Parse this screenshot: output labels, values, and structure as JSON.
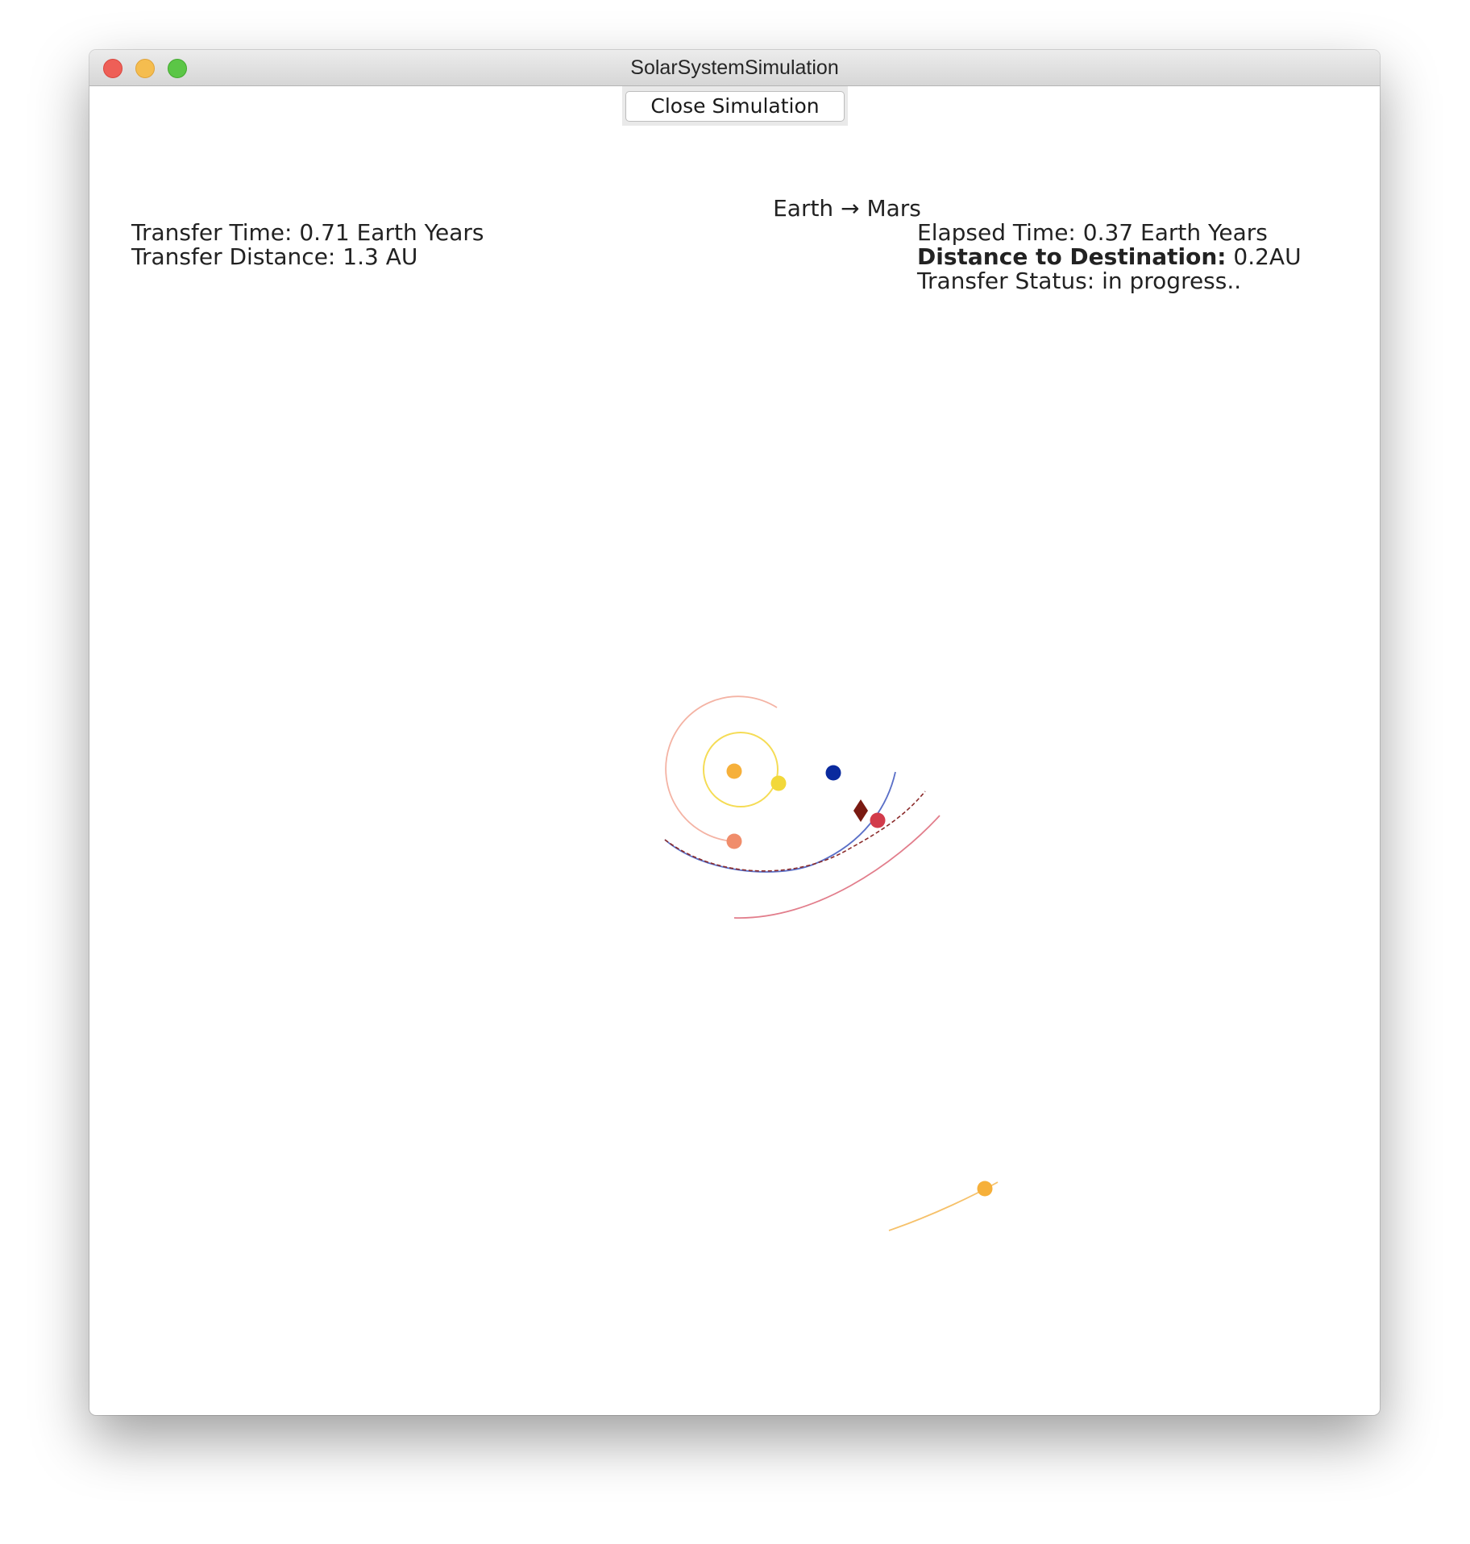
{
  "window": {
    "title": "SolarSystemSimulation"
  },
  "toolbar": {
    "close_label": "Close Simulation"
  },
  "route": {
    "origin": "Earth",
    "arrow": "→",
    "destination": "Mars"
  },
  "transfer": {
    "time_label": "Transfer Time:",
    "time_value": "0.71 Earth Years",
    "distance_label": "Transfer Distance:",
    "distance_value": "1.3 AU"
  },
  "status": {
    "elapsed_label": "Elapsed Time:",
    "elapsed_value": "0.37 Earth Years",
    "dest_label": "Distance to Destination:",
    "dest_value": "0.2AU",
    "status_label": "Transfer Status:",
    "status_value": "in progress.."
  },
  "colors": {
    "sun": "#f6b03a",
    "mercury": "#f2d83a",
    "venus": "#f08d6b",
    "earth": "#0a2a9e",
    "mars": "#d23b4b",
    "spacecraft": "#7a1a12",
    "outer_planet": "#f6b03a"
  }
}
